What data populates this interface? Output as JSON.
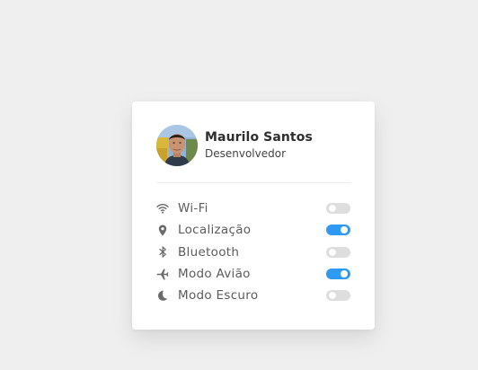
{
  "profile": {
    "name": "Maurilo Santos",
    "role": "Desenvolvedor"
  },
  "settings": [
    {
      "label": "Wi-Fi",
      "icon": "wifi-icon",
      "enabled": false
    },
    {
      "label": "Localização",
      "icon": "location-pin-icon",
      "enabled": true
    },
    {
      "label": "Bluetooth",
      "icon": "bluetooth-icon",
      "enabled": false
    },
    {
      "label": "Modo Avião",
      "icon": "airplane-icon",
      "enabled": true
    },
    {
      "label": "Modo Escuro",
      "icon": "moon-icon",
      "enabled": false
    }
  ],
  "colors": {
    "toggle_on": "#2e9af4",
    "toggle_off": "#dedede",
    "icon": "#6b6b6b"
  }
}
